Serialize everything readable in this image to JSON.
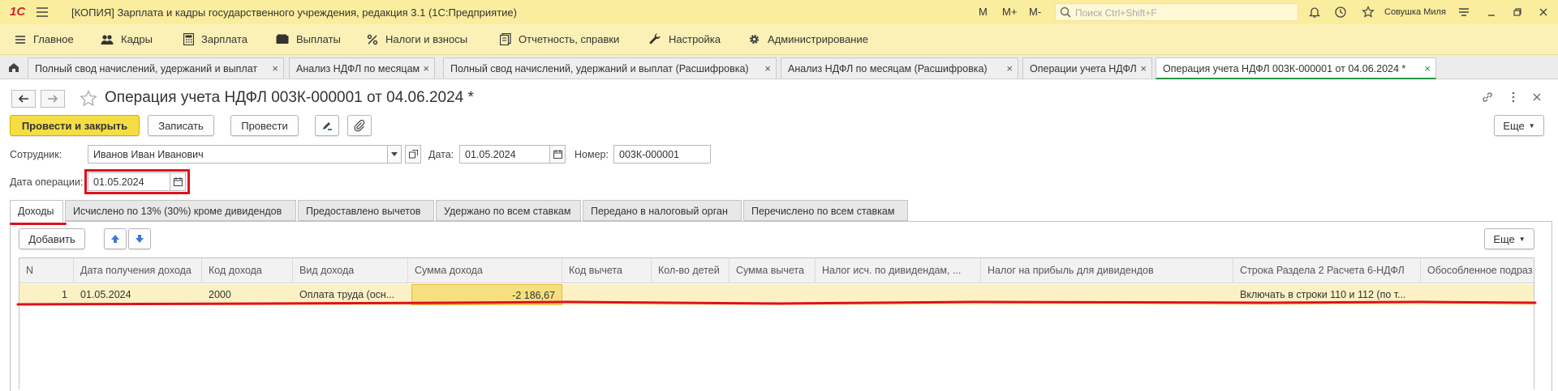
{
  "app": {
    "logo": "1С",
    "title": "[КОПИЯ] Зарплата и кадры государственного учреждения, редакция 3.1  (1С:Предприятие)",
    "memory_buttons": [
      "M",
      "M+",
      "M-"
    ],
    "search_placeholder": "Поиск Ctrl+Shift+F",
    "user": "Совушка Миля"
  },
  "sections": [
    {
      "label": "Главное",
      "icon": "menu-icon"
    },
    {
      "label": "Кадры",
      "icon": "people-icon"
    },
    {
      "label": "Зарплата",
      "icon": "calculator-icon"
    },
    {
      "label": "Выплаты",
      "icon": "wallet-icon"
    },
    {
      "label": "Налоги и взносы",
      "icon": "percent-icon"
    },
    {
      "label": "Отчетность, справки",
      "icon": "report-icon"
    },
    {
      "label": "Настройка",
      "icon": "wrench-icon"
    },
    {
      "label": "Администрирование",
      "icon": "gear-icon"
    }
  ],
  "open_tabs": [
    "Полный свод начислений, удержаний и выплат",
    "Анализ НДФЛ по месяцам",
    "Полный свод начислений, удержаний и выплат (Расшифровка)",
    "Анализ НДФЛ по месяцам (Расшифровка)",
    "Операции учета НДФЛ",
    "Операция учета НДФЛ 003К-000001 от 04.06.2024 *"
  ],
  "form": {
    "title": "Операция учета НДФЛ 003К-000001 от 04.06.2024 *",
    "buttons": {
      "post_close": "Провести и закрыть",
      "save": "Записать",
      "post": "Провести",
      "more": "Еще"
    },
    "employee_label": "Сотрудник:",
    "employee_value": "Иванов Иван Иванович",
    "date_label": "Дата:",
    "date_value": "01.05.2024",
    "number_label": "Номер:",
    "number_value": "003К-000001",
    "op_date_label": "Дата операции:",
    "op_date_value": "01.05.2024"
  },
  "form_tabs": [
    "Доходы",
    "Исчислено по 13% (30%) кроме дивидендов",
    "Предоставлено вычетов",
    "Удержано по всем ставкам",
    "Передано в налоговый орган",
    "Перечислено по всем ставкам"
  ],
  "table": {
    "add_button": "Добавить",
    "more_button": "Еще",
    "columns": [
      "N",
      "Дата получения дохода",
      "Код дохода",
      "Вид дохода",
      "Сумма дохода",
      "Код вычета",
      "Кол-во детей",
      "Сумма вычета",
      "Налог исч. по дивидендам, ...",
      "Налог на прибыль для дивидендов",
      "Строка Раздела 2 Расчета 6-НДФЛ",
      "Обособленное подраз"
    ],
    "rows": [
      {
        "n": "1",
        "date": "01.05.2024",
        "code": "2000",
        "kind": "Оплата труда (осн...",
        "amount": "-2 186,67",
        "deduction_code": "",
        "children": "",
        "deduction_sum": "",
        "div_tax": "",
        "profit_tax": "",
        "line_6ndfl": "Включать в строки 110 и 112 (по т...",
        "division": ""
      }
    ]
  },
  "colors": {
    "titlebar": "#fbed9e",
    "sections_bar": "#fbf1b7",
    "primary_button": "#f5de44",
    "active_tab_accent": "#2b9346",
    "selected_row": "#fbf1c4",
    "annotation_red": "#e0101a"
  }
}
